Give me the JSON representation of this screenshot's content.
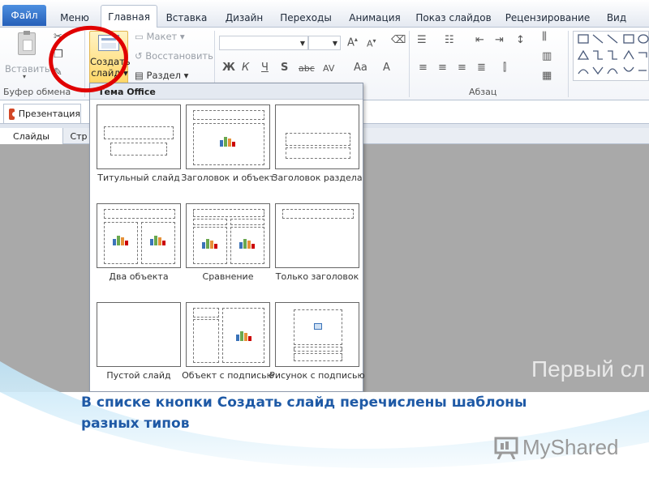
{
  "ribbon_tabs": {
    "file": "Файл",
    "items": [
      "Меню",
      "Главная",
      "Вставка",
      "Дизайн",
      "Переходы",
      "Анимация",
      "Показ слайдов",
      "Рецензирование",
      "Вид"
    ],
    "active": "Главная"
  },
  "clipboard": {
    "paste_label": "Вставить",
    "group_label": "Буфер обмена"
  },
  "slides": {
    "new_slide_line1": "Создать",
    "new_slide_line2": "слайд",
    "layout_label": "Макет",
    "reset_label": "Восстановить",
    "section_label": "Раздел"
  },
  "font": {
    "bold": "Ж",
    "italic": "К",
    "underline": "Ч",
    "shadow": "S",
    "strike": "abc",
    "spacing": "AV",
    "case": "Aa",
    "color": "A"
  },
  "paragraph": {
    "group_label": "Абзац"
  },
  "document": {
    "tab_label": "Презентация"
  },
  "panes": {
    "slides_tab": "Слайды",
    "outline_tab": "Стр"
  },
  "gallery": {
    "header": "Тема Office",
    "layouts": [
      {
        "name": "Титульный слайд"
      },
      {
        "name": "Заголовок и объект"
      },
      {
        "name": "Заголовок раздела"
      },
      {
        "name": "Два объекта"
      },
      {
        "name": "Сравнение"
      },
      {
        "name": "Только заголовок"
      },
      {
        "name": "Пустой слайд"
      },
      {
        "name": "Объект с подписью"
      },
      {
        "name": "Рисунок с подписью"
      }
    ]
  },
  "slide": {
    "title_text": "Первый сл"
  },
  "caption": "В списке кнопки Создать слайд перечислены шаблоны разных типов",
  "watermark": "MyShared",
  "colors": {
    "annotation_red": "#e00000",
    "caption_blue": "#1f5aa6",
    "file_tab_blue": "#2660b9",
    "workspace_gray": "#a9a9a9"
  }
}
